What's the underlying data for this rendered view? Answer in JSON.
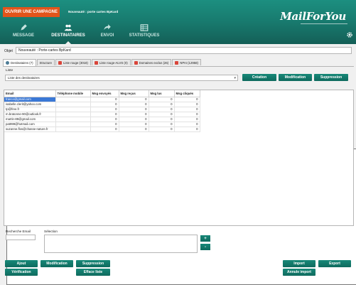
{
  "header": {
    "open_button": "OUVRIR UNE CAMPAGNE",
    "campaign_title": "Nouveauté : porte cartes BpKard",
    "logo": "MailForYou",
    "nav": [
      {
        "label": "MESSAGE",
        "icon": "pencil-icon"
      },
      {
        "label": "DESTINATAIRES",
        "icon": "users-icon",
        "active": true
      },
      {
        "label": "ENVOI",
        "icon": "send-arrow-icon"
      },
      {
        "label": "STATISTIQUES",
        "icon": "stats-icon"
      }
    ]
  },
  "objet": {
    "label": "Objet",
    "value": "Nouveauté : Porte-cartes BpKard"
  },
  "tabs": [
    {
      "label": "Destinataires (7)",
      "icon": "dest"
    },
    {
      "label": "Structure",
      "icon": "grid"
    },
    {
      "label": "Liste rouge (3018)",
      "icon": "red"
    },
    {
      "label": "Liste rouge-ALVS (0)",
      "icon": "red"
    },
    {
      "label": "Domaines exclus (26)",
      "icon": "red"
    },
    {
      "label": "NPAI (12958)",
      "icon": "red"
    }
  ],
  "liste": {
    "label": "Liste",
    "value": "Liste des destinataires"
  },
  "top_buttons": {
    "creation": "Création",
    "modification": "Modification",
    "suppression": "Suppression"
  },
  "table": {
    "columns": [
      "Email",
      "Téléphone mobile",
      "Msg envoyés",
      "Msg reçus",
      "Msg lus",
      "Msg cliqués"
    ],
    "rows": [
      [
        "franco@gmail.com",
        "",
        "0",
        "0",
        "0",
        "0"
      ],
      [
        "isabelle.clerit@yahoo.com",
        "",
        "0",
        "0",
        "0",
        "0"
      ],
      [
        "tp@free.fr",
        "",
        "0",
        "0",
        "0",
        "0"
      ],
      [
        "m.bratonne-90@outlook.fr",
        "",
        "0",
        "0",
        "0",
        "0"
      ],
      [
        "martin-89@gmail.com",
        "",
        "0",
        "0",
        "0",
        "0"
      ],
      [
        "pat999@hotmail.com",
        "",
        "0",
        "0",
        "0",
        "0"
      ],
      [
        "suzanne.flos@chasse-nature.fr",
        "",
        "0",
        "0",
        "0",
        "0"
      ]
    ]
  },
  "search": {
    "label": "Recherche Email",
    "value": ""
  },
  "selection": {
    "label": "Sélection",
    "add": "+",
    "remove": "-"
  },
  "bottom_buttons": {
    "ajout": "Ajout",
    "modification": "Modification",
    "suppression": "Suppression",
    "verification": "Vérification",
    "efface_liste": "Efface liste",
    "import": "Import",
    "export": "Export",
    "annule_import": "Annule import"
  },
  "colors": {
    "header": "#187a6e",
    "accent_orange": "#e2541b",
    "button": "#0f6a5e",
    "selection": "#3a78d6"
  }
}
